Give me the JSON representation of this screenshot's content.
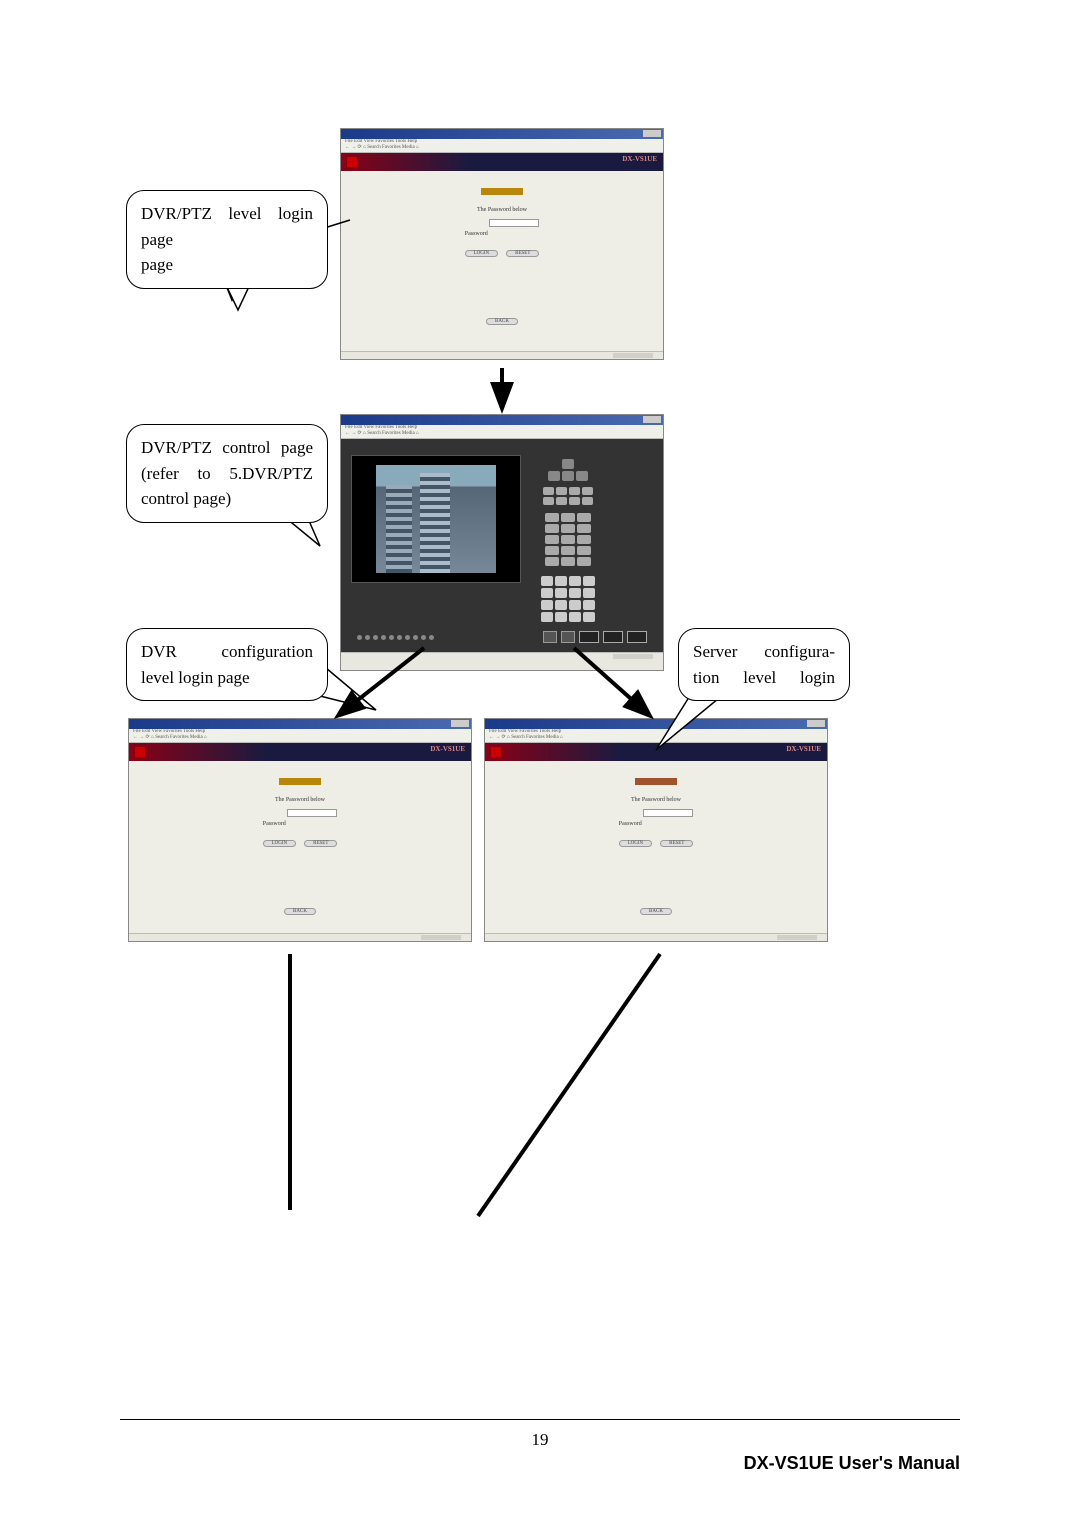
{
  "callouts": {
    "c1": "DVR/PTZ level login page",
    "c2_l1": "DVR/PTZ control page",
    "c2_l2": "(refer to 5.DVR/PTZ",
    "c2_l3": "control page)",
    "c3_l1": "DVR configuration",
    "c3_l2": "level login page",
    "c4_l1": "Server configura-",
    "c4_l2": "tion level login"
  },
  "thumb": {
    "brand": "DX-VS1UE",
    "pwd_label": "Password",
    "login": "LOGIN",
    "reset": "RESET",
    "back": "BACK"
  },
  "footer": {
    "page": "19",
    "title": "DX-VS1UE User's Manual"
  }
}
